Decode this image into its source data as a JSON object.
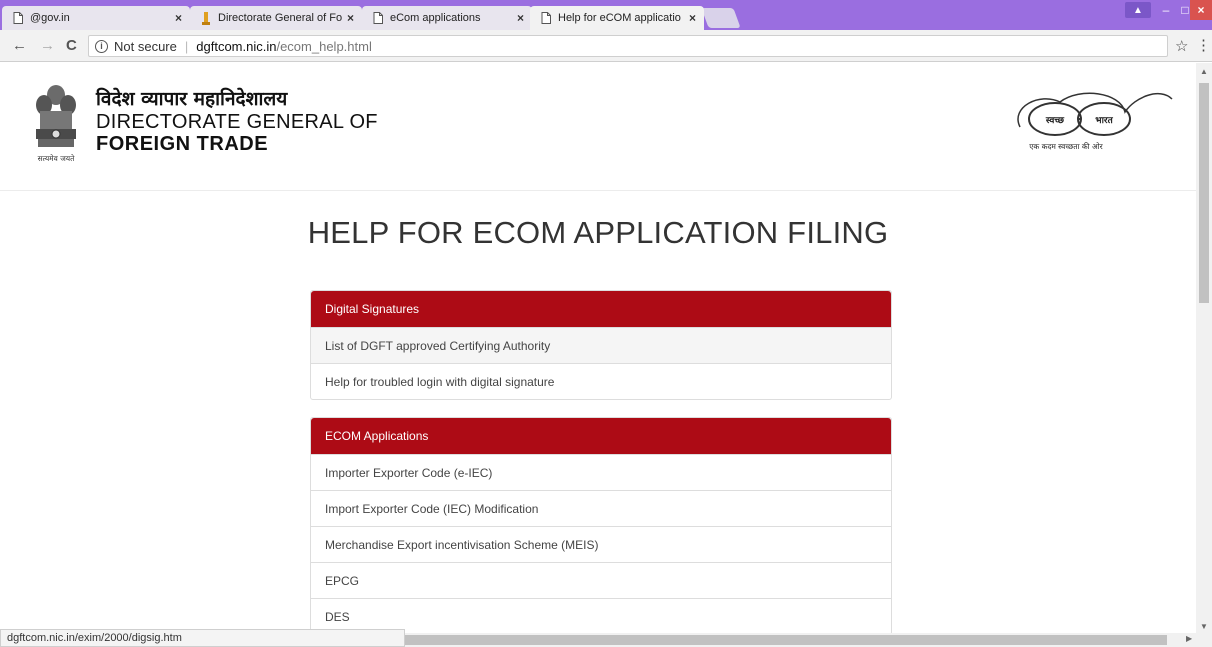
{
  "browser": {
    "tabs": [
      {
        "title": "@gov.in",
        "icon": "page-icon"
      },
      {
        "title": "Directorate General of Fo",
        "icon": "favicon-dgft"
      },
      {
        "title": "eCom applications",
        "icon": "page-icon"
      },
      {
        "title": "Help for eCOM applicatio",
        "icon": "page-icon",
        "active": true
      }
    ],
    "tab_close": "×",
    "back": "←",
    "forward": "→",
    "reload": "C",
    "security_label": "Not secure",
    "url_host": "dgftcom.nic.in",
    "url_path": "/ecom_help.html",
    "star": "☆",
    "menu": "⋮",
    "window_controls": {
      "minimize": "–",
      "maximize": "□",
      "close": "×"
    }
  },
  "header": {
    "hindi_name": "विदेश व्यापार महानिदेशालय",
    "name_line1": "DIRECTORATE GENERAL OF",
    "name_line2": "FOREIGN TRADE",
    "emblem_caption": "सत्यमेव जयते",
    "swachh_word1": "स्वच्छ",
    "swachh_word2": "भारत",
    "swachh_tagline": "एक कदम स्वच्छता की ओर"
  },
  "page_title": "HELP FOR ECOM APPLICATION FILING",
  "panels": [
    {
      "heading": "Digital Signatures",
      "items": [
        "List of DGFT approved Certifying Authority",
        "Help for troubled login with digital signature"
      ]
    },
    {
      "heading": "ECOM Applications",
      "items": [
        "Importer Exporter Code (e-IEC)",
        "Import Exporter Code (IEC) Modification",
        "Merchandise Export incentivisation Scheme (MEIS)",
        "EPCG",
        "DES"
      ]
    }
  ],
  "status_url": "dgftcom.nic.in/exim/2000/digsig.htm",
  "colors": {
    "tabbar": "#9a6ee0",
    "panel_heading": "#ad0b15"
  }
}
